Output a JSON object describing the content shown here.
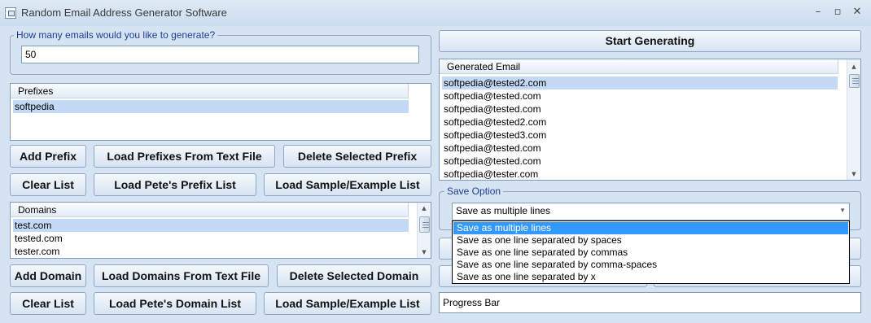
{
  "window": {
    "title": "Random Email Address Generator Software",
    "minimize": "–",
    "maximize": "▫",
    "close": "✕"
  },
  "count_group": {
    "label": "How many emails would you like to generate?",
    "value": "50"
  },
  "prefixes": {
    "header": "Prefixes",
    "items": [
      "softpedia"
    ]
  },
  "prefix_buttons": {
    "add": "Add Prefix",
    "load_file": "Load Prefixes From Text File",
    "delete_selected": "Delete Selected Prefix",
    "clear": "Clear List",
    "load_petes": "Load Pete's Prefix List",
    "load_sample": "Load Sample/Example List"
  },
  "domains": {
    "header": "Domains",
    "items": [
      "test.com",
      "tested.com",
      "tester.com"
    ]
  },
  "domain_buttons": {
    "add": "Add Domain",
    "load_file": "Load Domains From Text File",
    "delete_selected": "Delete Selected Domain",
    "clear": "Clear List",
    "load_petes": "Load Pete's Domain List",
    "load_sample": "Load Sample/Example List"
  },
  "start_button": "Start Generating",
  "generated": {
    "header": "Generated Email",
    "items": [
      "softpedia@tested2.com",
      "softpedia@tested.com",
      "softpedia@tested.com",
      "softpedia@tested2.com",
      "softpedia@tested3.com",
      "softpedia@tested.com",
      "softpedia@tested.com",
      "softpedia@tester.com"
    ]
  },
  "save_option": {
    "label": "Save Option",
    "selected": "Save as multiple lines",
    "options": [
      "Save as multiple lines",
      "Save as one line separated by spaces",
      "Save as one line separated by commas",
      "Save as one line separated by comma-spaces",
      "Save as one line separated by x"
    ]
  },
  "progress_bar": {
    "label": "Progress Bar"
  }
}
